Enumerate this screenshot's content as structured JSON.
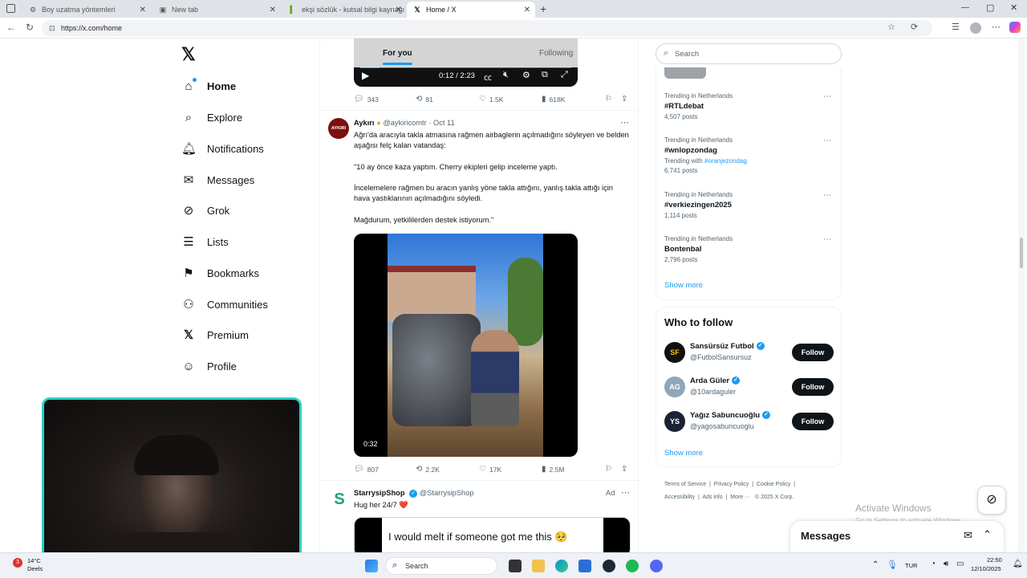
{
  "browser": {
    "tabs": [
      {
        "label": "Boy uzatma yöntemleri",
        "active": false
      },
      {
        "label": "New tab",
        "active": false
      },
      {
        "label": "ekşi sözlük - kutsal bilgi kaynağı",
        "active": false
      },
      {
        "label": "Home / X",
        "active": true
      }
    ],
    "url": "https://x.com/home"
  },
  "nav": {
    "logo": "x-logo",
    "items": [
      {
        "label": "Home",
        "icon": "home-icon"
      },
      {
        "label": "Explore",
        "icon": "search-icon"
      },
      {
        "label": "Notifications",
        "icon": "bell-icon"
      },
      {
        "label": "Messages",
        "icon": "mail-icon"
      },
      {
        "label": "Grok",
        "icon": "grok-icon"
      },
      {
        "label": "Lists",
        "icon": "list-icon"
      },
      {
        "label": "Bookmarks",
        "icon": "bookmark-icon"
      },
      {
        "label": "Communities",
        "icon": "communities-icon"
      },
      {
        "label": "Premium",
        "icon": "x-icon"
      },
      {
        "label": "Profile",
        "icon": "person-icon"
      }
    ]
  },
  "feed": {
    "tabs": {
      "for_you": "For you",
      "following": "Following"
    },
    "video1": {
      "time": "0:12 / 2:23",
      "progress": 0.09
    },
    "tweet1_metrics": {
      "replies": "343",
      "reposts": "81",
      "likes": "1.5K",
      "views": "618K"
    },
    "tweet2": {
      "avatar_text": "AYKIRI",
      "name": "Aykırı",
      "handle": "@aykiricomtr",
      "date": "· Oct 11",
      "paragraphs": [
        "Ağrı'da aracıyla takla atmasına rağmen airbaglerin açılmadığını söyleyen ve belden aşağısı felç kalan vatandaş:",
        "\"10 ay önce kaza yaptım. Cherry ekipleri gelip inceleme yaptı.",
        "İncelemelere rağmen bu aracın yanlış yöne takla attığını, yanlış takla attığı için hava yastıklarının açılmadığını söyledi.",
        "Mağdurum, yetkililerden destek istiyorum.\""
      ],
      "video_duration": "0:32",
      "metrics": {
        "replies": "807",
        "reposts": "2.2K",
        "likes": "17K",
        "views": "2.5M"
      }
    },
    "tweet3": {
      "name": "StarrysipShop",
      "handle": "@StarrysipShop",
      "ad_label": "Ad",
      "text": "Hug her 24/7 ❤️",
      "image_text": "I would melt if someone got me this 🥺"
    }
  },
  "sidebar": {
    "search_placeholder": "Search",
    "trends": [
      {
        "context": "Trending in Netherlands",
        "title": "#RTLdebat",
        "extra_label": "",
        "extra_link": "",
        "posts": "4,507 posts"
      },
      {
        "context": "Trending in Netherlands",
        "title": "#wnlopzondag",
        "extra_label": "Trending with",
        "extra_link": "#oranjezondag",
        "posts": "6,741 posts"
      },
      {
        "context": "Trending in Netherlands",
        "title": "#verkiezingen2025",
        "extra_label": "",
        "extra_link": "",
        "posts": "1,114 posts"
      },
      {
        "context": "Trending in Netherlands",
        "title": "Bontenbal",
        "extra_label": "",
        "extra_link": "",
        "posts": "2,796 posts"
      }
    ],
    "show_more": "Show more",
    "who_to_follow": {
      "title": "Who to follow",
      "accounts": [
        {
          "name": "Sansürsüz Futbol",
          "handle": "@FutbolSansursuz",
          "avatar": "SF",
          "button": "Follow"
        },
        {
          "name": "Arda Güler",
          "handle": "@10ardaguler",
          "avatar": "AG",
          "button": "Follow"
        },
        {
          "name": "Yağız Sabuncuoğlu",
          "handle": "@yagosabuncuoglu",
          "avatar": "YS",
          "button": "Follow"
        }
      ],
      "show_more": "Show more"
    },
    "footer": [
      "Terms of Service",
      "Privacy Policy",
      "Cookie Policy",
      "Accessibility",
      "Ads info",
      "More ···",
      "© 2025 X Corp."
    ]
  },
  "messages_drawer": {
    "title": "Messages"
  },
  "windows_watermark": {
    "title": "Activate Windows",
    "subtitle": "Go to Settings to activate Windows."
  },
  "taskbar": {
    "weather_temp": "14°C",
    "weather_desc": "Deels",
    "search_label": "Search",
    "language": "TUR",
    "time": "22:50",
    "date": "12/10/2025"
  },
  "colors": {
    "accent": "#1d9bf0",
    "text": "#0f1419",
    "muted": "#536471",
    "like_red": "#f91880"
  }
}
